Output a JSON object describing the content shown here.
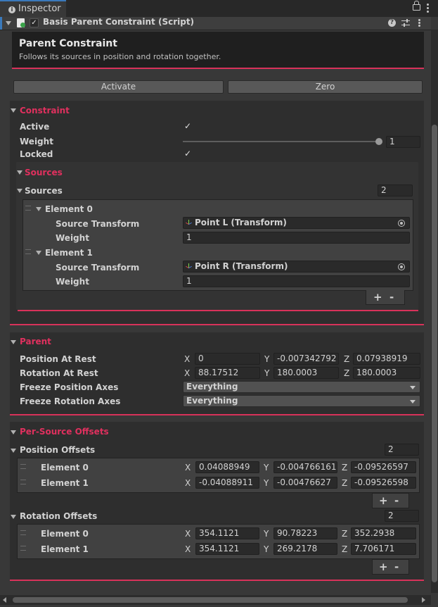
{
  "window": {
    "tab_label": "Inspector",
    "info_icon": "i"
  },
  "component": {
    "title": "Basis Parent Constraint (Script)"
  },
  "header": {
    "title": "Parent Constraint",
    "description": "Follows its sources in position and rotation together."
  },
  "buttons": {
    "activate": "Activate",
    "zero": "Zero"
  },
  "constraint": {
    "section_title": "Constraint",
    "active_label": "Active",
    "weight_label": "Weight",
    "weight_value": "1",
    "weight_slider": 1,
    "locked_label": "Locked"
  },
  "sources": {
    "section_title": "Sources",
    "list_label": "Sources",
    "count": "2",
    "elements": [
      {
        "label": "Element 0",
        "source_label": "Source Transform",
        "source_value": "Point L (Transform)",
        "weight_label": "Weight",
        "weight_value": "1"
      },
      {
        "label": "Element 1",
        "source_label": "Source Transform",
        "source_value": "Point R (Transform)",
        "weight_label": "Weight",
        "weight_value": "1"
      }
    ],
    "add": "+",
    "remove": "-"
  },
  "parent": {
    "section_title": "Parent",
    "axis": {
      "x": "X",
      "y": "Y",
      "z": "Z"
    },
    "position_label": "Position At Rest",
    "position": [
      "0",
      "-0.007342792",
      "0.07938919"
    ],
    "rotation_label": "Rotation At Rest",
    "rotation": [
      "88.17512",
      "180.0003",
      "180.0003"
    ],
    "freeze_pos_label": "Freeze Position Axes",
    "freeze_pos_value": "Everything",
    "freeze_rot_label": "Freeze Rotation Axes",
    "freeze_rot_value": "Everything"
  },
  "offsets": {
    "section_title": "Per-Source Offsets",
    "position_label": "Position Offsets",
    "position_count": "2",
    "position_rows": [
      {
        "label": "Element 0",
        "x": "0.04088949",
        "y": "-0.004766161",
        "z": "-0.09526597"
      },
      {
        "label": "Element 1",
        "x": "-0.04088911",
        "y": "-0.00476627",
        "z": "-0.09526598"
      }
    ],
    "rotation_label": "Rotation Offsets",
    "rotation_count": "2",
    "rotation_rows": [
      {
        "label": "Element 0",
        "x": "354.1121",
        "y": "90.78223",
        "z": "352.2938"
      },
      {
        "label": "Element 1",
        "x": "354.1121",
        "y": "269.2178",
        "z": "7.706171"
      }
    ],
    "add": "+",
    "remove": "-"
  },
  "colors": {
    "accent": "#e0305e",
    "background": "#383838",
    "panel": "#2e2e2e"
  }
}
